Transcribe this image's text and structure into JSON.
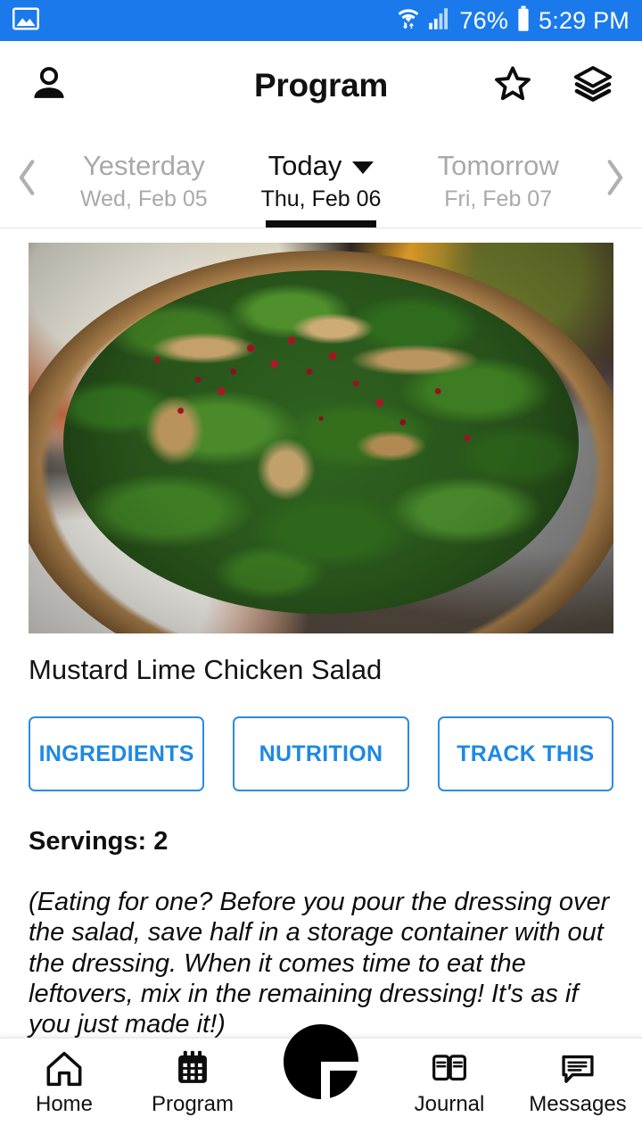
{
  "statusbar": {
    "battery_percent": "76%",
    "time": "5:29 PM",
    "icons": [
      "image-icon",
      "wifi-icon",
      "signal-icon",
      "battery-icon"
    ],
    "background_color": "#1a7aec"
  },
  "appbar": {
    "title": "Program",
    "profile_icon": "person-icon",
    "favorite_icon": "star-icon",
    "layers_icon": "layers-icon"
  },
  "datenav": {
    "prev_arrow": "chevron-left-icon",
    "next_arrow": "chevron-right-icon",
    "days": [
      {
        "label": "Yesterday",
        "date": "Wed, Feb 05",
        "active": false
      },
      {
        "label": "Today",
        "date": "Thu, Feb 06",
        "active": true
      },
      {
        "label": "Tomorrow",
        "date": "Fri, Feb 07",
        "active": false
      }
    ],
    "dropdown_icon": "chevron-down-icon"
  },
  "recipe": {
    "image_alt": "mustard-lime-chicken-salad-photo",
    "title": "Mustard Lime Chicken Salad",
    "buttons": [
      {
        "label": "INGREDIENTS"
      },
      {
        "label": "NUTRITION"
      },
      {
        "label": "TRACK THIS"
      }
    ],
    "servings": "Servings: 2",
    "note": "(Eating for one? Before you pour the dressing over the salad, save half in a storage container with out the dressing. When it comes time to eat the leftovers, mix in the remaining dressing! It's as if you just made it!)",
    "accent_color": "#1e88e5"
  },
  "bottomnav": {
    "items": [
      {
        "label": "Home",
        "icon": "home-icon"
      },
      {
        "label": "Program",
        "icon": "calendar-icon"
      },
      {
        "label": "Journal",
        "icon": "book-icon"
      },
      {
        "label": "Messages",
        "icon": "chat-icon"
      }
    ],
    "fab_icon": "plus-icon"
  }
}
